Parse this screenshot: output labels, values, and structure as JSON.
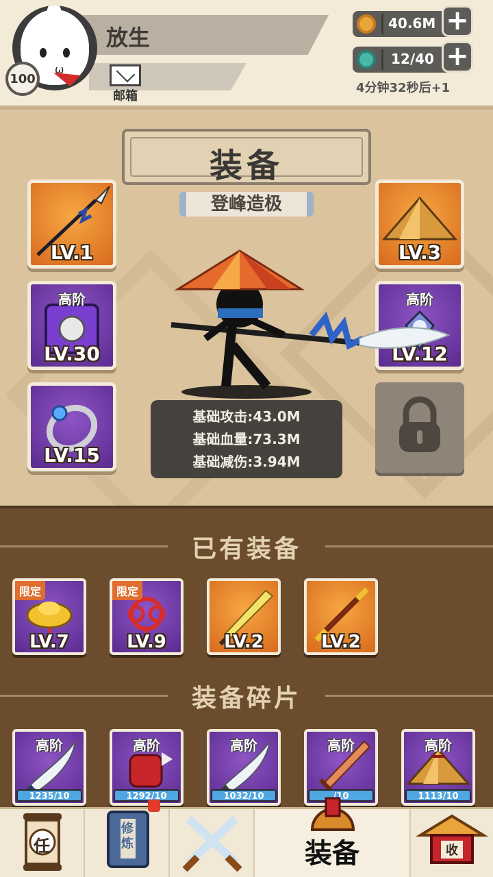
{
  "player": {
    "name": "放生",
    "level": "100",
    "mail_label": "邮箱"
  },
  "resources": {
    "coins": "40.6M",
    "stamina": "12/40",
    "timer": "4分钟32秒后+1"
  },
  "equip_panel": {
    "title": "装备",
    "subtitle": "登峰造极",
    "slots": [
      {
        "icon": "spear-icon",
        "rarity": "orange",
        "tier": "",
        "level": "LV.1"
      },
      {
        "icon": "armor-icon",
        "rarity": "purple",
        "tier": "高阶",
        "level": "LV.30"
      },
      {
        "icon": "ring-icon",
        "rarity": "purple",
        "tier": "",
        "level": "LV.15"
      },
      {
        "icon": "straw-hat-icon",
        "rarity": "orange",
        "tier": "",
        "level": "LV.3"
      },
      {
        "icon": "amulet-icon",
        "rarity": "purple",
        "tier": "高阶",
        "level": "LV.12"
      },
      {
        "icon": "lock-icon",
        "rarity": "locked",
        "tier": "",
        "level": ""
      }
    ],
    "stats": [
      "基础攻击:43.0M",
      "基础血量:73.3M",
      "基础减伤:3.94M"
    ]
  },
  "owned": {
    "title": "已有装备",
    "items": [
      {
        "icon": "gold-ingot-icon",
        "rarity": "purple",
        "badge": "限定",
        "level": "LV.7"
      },
      {
        "icon": "chinese-knot-icon",
        "rarity": "purple",
        "badge": "限定",
        "level": "LV.9"
      },
      {
        "icon": "golden-sword-icon",
        "rarity": "orange",
        "badge": "",
        "level": "LV.2"
      },
      {
        "icon": "staff-icon",
        "rarity": "orange",
        "badge": "",
        "level": "LV.2"
      }
    ]
  },
  "fragments": {
    "title": "装备碎片",
    "items": [
      {
        "icon": "blade-icon",
        "tier": "高阶",
        "progress": "1235/10"
      },
      {
        "icon": "red-gauntlet-icon",
        "tier": "高阶",
        "progress": "1292/10"
      },
      {
        "icon": "blade-icon",
        "tier": "高阶",
        "progress": "1032/10"
      },
      {
        "icon": "wooden-sword-icon",
        "tier": "高阶",
        "progress": "/10"
      },
      {
        "icon": "straw-hat-icon",
        "tier": "高阶",
        "progress": "1113/10"
      }
    ]
  },
  "nav": [
    {
      "icon": "task-scroll-icon",
      "label": "任"
    },
    {
      "icon": "cultivate-book-icon",
      "label": "修炼"
    },
    {
      "icon": "crossed-swords-icon",
      "label": ""
    },
    {
      "icon": "helmet-icon",
      "label": "装备"
    },
    {
      "icon": "collect-house-icon",
      "label": "收"
    }
  ],
  "colors": {
    "orange": "#e8862e",
    "purple": "#6c3aa3",
    "panel": "#dac39d",
    "bag": "#6b4d2e"
  }
}
